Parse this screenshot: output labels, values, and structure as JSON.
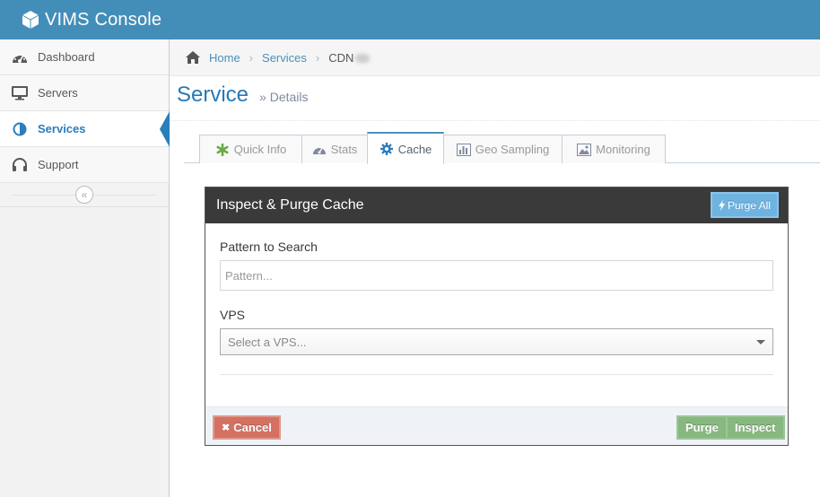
{
  "app": {
    "title": "VIMS Console"
  },
  "sidebar": {
    "items": [
      {
        "label": "Dashboard",
        "icon": "dashboard-icon"
      },
      {
        "label": "Servers",
        "icon": "desktop-icon"
      },
      {
        "label": "Services",
        "icon": "adjust-icon",
        "active": true
      },
      {
        "label": "Support",
        "icon": "headphones-icon"
      }
    ],
    "collapse_glyph": "«"
  },
  "breadcrumb": {
    "home": "Home",
    "services": "Services",
    "current": "CDN"
  },
  "page": {
    "title": "Service",
    "subtitle": "» Details"
  },
  "tabs": [
    {
      "label": "Quick Info",
      "icon": "asterisk-icon"
    },
    {
      "label": "Stats",
      "icon": "tachometer-icon"
    },
    {
      "label": "Cache",
      "icon": "cog-icon",
      "active": true
    },
    {
      "label": "Geo Sampling",
      "icon": "bar-chart-icon"
    },
    {
      "label": "Monitoring",
      "icon": "picture-icon"
    }
  ],
  "panel": {
    "title": "Inspect & Purge Cache",
    "purge_all_label": "Purge All",
    "pattern_label": "Pattern to Search",
    "pattern_placeholder": "Pattern...",
    "pattern_value": "",
    "vps_label": "VPS",
    "vps_placeholder": "Select a VPS...",
    "cancel_label": "Cancel",
    "purge_label": "Purge",
    "inspect_label": "Inspect"
  },
  "colors": {
    "navbar": "#438eb9",
    "accent": "#2b7dbc",
    "panel_header": "#3a3a3a",
    "success": "#87b87f",
    "danger": "#d15b47",
    "info": "#6fb3e0"
  }
}
